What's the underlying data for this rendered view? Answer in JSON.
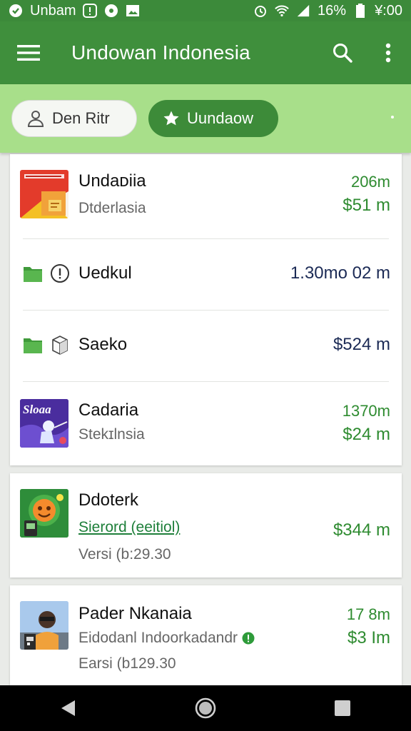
{
  "status_bar": {
    "carrier": "Unbam",
    "battery": "16%",
    "time": "¥:00"
  },
  "app_bar": {
    "title": "Undowan Indonesia",
    "search_icon": "search-icon",
    "more_icon": "more-vertical-icon",
    "menu_icon": "hamburger-menu-icon"
  },
  "filters": [
    {
      "label": "Den Ritr",
      "icon": "person-icon",
      "selected": false
    },
    {
      "label": "Uundaow",
      "icon": "star-icon",
      "selected": true
    }
  ],
  "list": [
    {
      "name": "Undaᴅiia",
      "sub": "Dtderlasia",
      "val1": "206m",
      "val2": "$51 m",
      "thumb": "undaia-thumb"
    },
    {
      "name": "Uedkul",
      "value": "1.30mo 02 m",
      "icons": [
        "folder-icon",
        "alert-circle-icon"
      ]
    },
    {
      "name": "Saeko",
      "value": "$524 m",
      "icons": [
        "folder-icon",
        "box-icon"
      ]
    },
    {
      "name": "Cadaria",
      "sub": "Stekɪlnsia",
      "val1": "1370m",
      "val2": "$24 m",
      "thumb": "cadaria-thumb",
      "thumb_text": "Sloaa"
    },
    {
      "name": "Ddoterk",
      "link": "Sierord (eeitiol)",
      "meta": "Versi (b:29.30",
      "val": "$344 m",
      "thumb": "ddoterk-thumb"
    },
    {
      "name": "Pader Nkanaia",
      "sub": "Eidodanl Indoorkadandr",
      "meta": "Earsi (b129.30",
      "val1": "17 8m",
      "val2": "$3 Im",
      "thumb": "pader-thumb"
    }
  ],
  "colors": {
    "primary": "#3f8f3c",
    "status_bar": "#3c8a3a",
    "chip_bar": "#a8df8a",
    "accent_text": "#2e8b30",
    "navy_text": "#1b2a55"
  }
}
